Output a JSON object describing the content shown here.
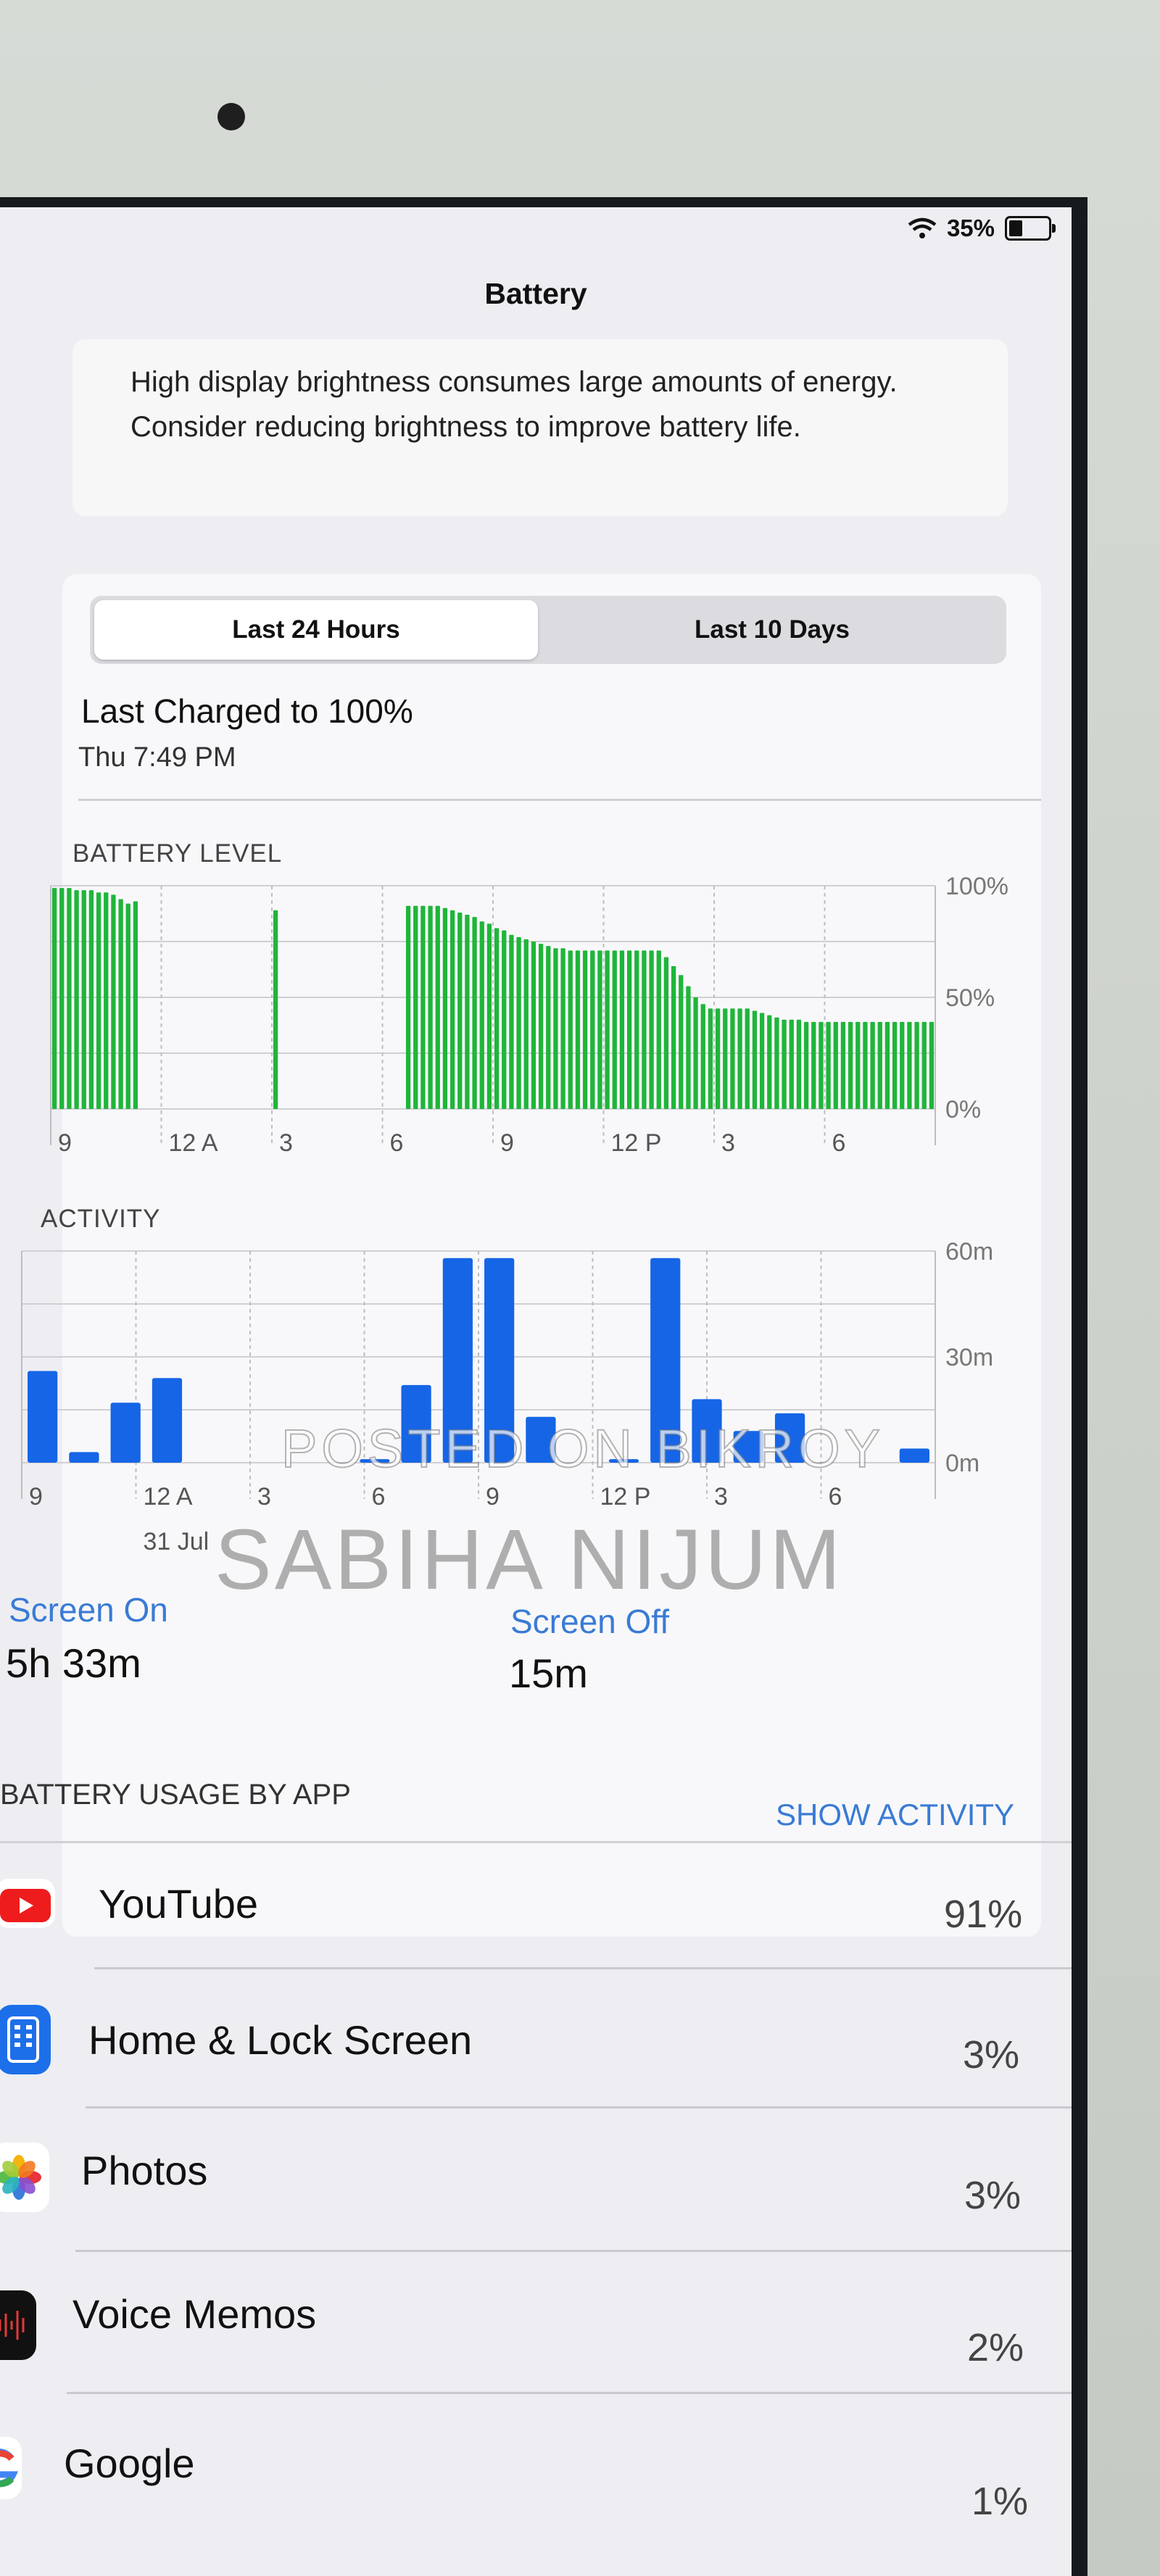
{
  "status_bar": {
    "battery_percent_text": "35%",
    "battery_level": 0.35
  },
  "nav": {
    "title": "Battery"
  },
  "notice": {
    "text": "High display brightness consumes large amounts of energy. Consider reducing brightness to improve battery life."
  },
  "tabs": [
    {
      "label": "Last 24 Hours",
      "selected": true
    },
    {
      "label": "Last 10 Days",
      "selected": false
    }
  ],
  "last_charged": {
    "title": "Last Charged to 100%",
    "time": "Thu 7:49 PM"
  },
  "chart_data": [
    {
      "type": "bar",
      "title": "BATTERY LEVEL",
      "y_tick_labels": [
        "100%",
        "50%",
        "0%"
      ],
      "ylim": [
        0,
        100
      ],
      "x_tick_labels": [
        "9",
        "12 A",
        "3",
        "6",
        "9",
        "12 P",
        "3",
        "6"
      ],
      "bar_color": "#1fb53a",
      "values": [
        99,
        99,
        99,
        98,
        98,
        98,
        97,
        97,
        96,
        94,
        92,
        93,
        0,
        0,
        0,
        0,
        0,
        0,
        0,
        0,
        0,
        0,
        0,
        0,
        0,
        0,
        0,
        0,
        0,
        0,
        89,
        0,
        0,
        0,
        0,
        0,
        0,
        0,
        0,
        0,
        0,
        0,
        0,
        0,
        0,
        0,
        0,
        0,
        91,
        91,
        91,
        91,
        91,
        90,
        89,
        88,
        87,
        86,
        84,
        83,
        81,
        80,
        78,
        77,
        76,
        75,
        74,
        73,
        72,
        72,
        71,
        71,
        71,
        71,
        71,
        71,
        71,
        71,
        71,
        71,
        71,
        71,
        71,
        68,
        64,
        60,
        55,
        50,
        47,
        45,
        45,
        45,
        45,
        45,
        45,
        44,
        43,
        42,
        41,
        40,
        40,
        40,
        39,
        39,
        39,
        39,
        39,
        39,
        39,
        39,
        39,
        39,
        39,
        39,
        39,
        39,
        39,
        39,
        39,
        39
      ]
    },
    {
      "type": "bar",
      "title": "ACTIVITY",
      "y_tick_labels": [
        "60m",
        "30m",
        "0m"
      ],
      "ylim": [
        0,
        60
      ],
      "x_tick_labels": [
        "9",
        "12 A",
        "3",
        "6",
        "9",
        "12 P",
        "3",
        "6"
      ],
      "x_sub_label": "31 Jul",
      "bar_color": "#1565e6",
      "values": [
        26,
        3,
        17,
        24,
        0,
        0,
        0,
        0,
        1,
        22,
        58,
        58,
        13,
        0,
        1,
        58,
        18,
        9,
        14,
        0,
        0,
        4
      ]
    }
  ],
  "screen_time": {
    "on_label": "Screen On",
    "on_value": "5h 33m",
    "off_label": "Screen Off",
    "off_value": "15m"
  },
  "usage": {
    "header": "BATTERY USAGE BY APP",
    "action": "SHOW ACTIVITY",
    "apps": [
      {
        "name": "YouTube",
        "percent": "91%",
        "icon": "youtube-icon"
      },
      {
        "name": "Home & Lock Screen",
        "percent": "3%",
        "icon": "home-lock-screen-icon"
      },
      {
        "name": "Photos",
        "percent": "3%",
        "icon": "photos-icon"
      },
      {
        "name": "Voice Memos",
        "percent": "2%",
        "icon": "voice-memos-icon"
      },
      {
        "name": "Google",
        "percent": "1%",
        "icon": "google-icon"
      }
    ]
  },
  "watermark": {
    "line1": "POSTED ON BIKROY",
    "line2": "SABIHA NIJUM"
  },
  "colors": {
    "accent": "#3a7bd5",
    "battery_green": "#1fb53a",
    "activity_blue": "#1565e6"
  }
}
